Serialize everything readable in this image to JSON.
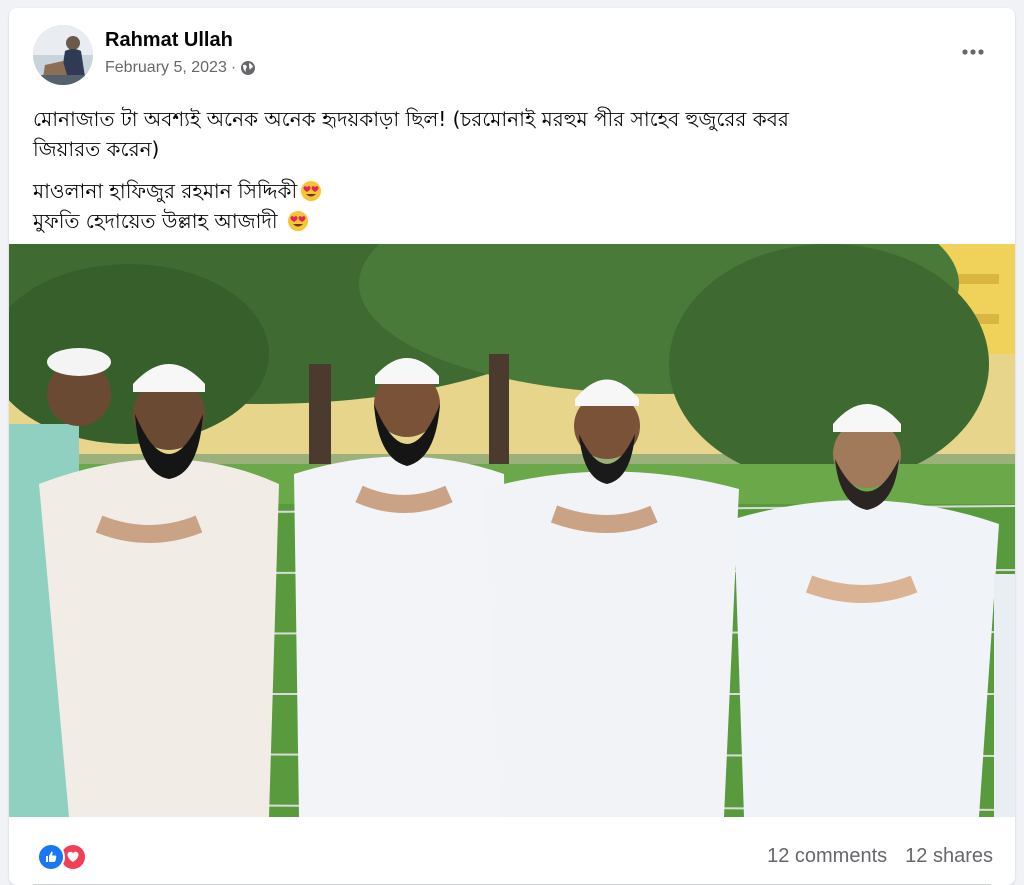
{
  "post": {
    "author": "Rahmat Ullah",
    "date": "February 5, 2023",
    "separator": "·",
    "audience_icon": "globe-icon",
    "more_icon": "more-options-icon",
    "text": {
      "line1": "মোনাজাত টা অবশ্যই অনেক অনেক হৃদয়কাড়া ছিল! (চরমোনাই মরহুম পীর সাহেব হুজুরের কবর",
      "line2": "জিয়ারত করেন)",
      "line3": "মাওলানা হাফিজুর রহমান সিদ্দিকী",
      "line4": "মুফতি  হেদায়েত উল্লাহ আজাদী"
    },
    "emoji_icon": "heart-eyes-emoji-icon",
    "reactions": [
      "like-icon",
      "love-icon"
    ],
    "comments": "12 comments",
    "shares": "12 shares"
  },
  "colors": {
    "background": "#f0f2f5",
    "card": "#ffffff",
    "secondary_text": "#65676b",
    "like_blue": "#1877f2",
    "love_red": "#f33e58"
  }
}
